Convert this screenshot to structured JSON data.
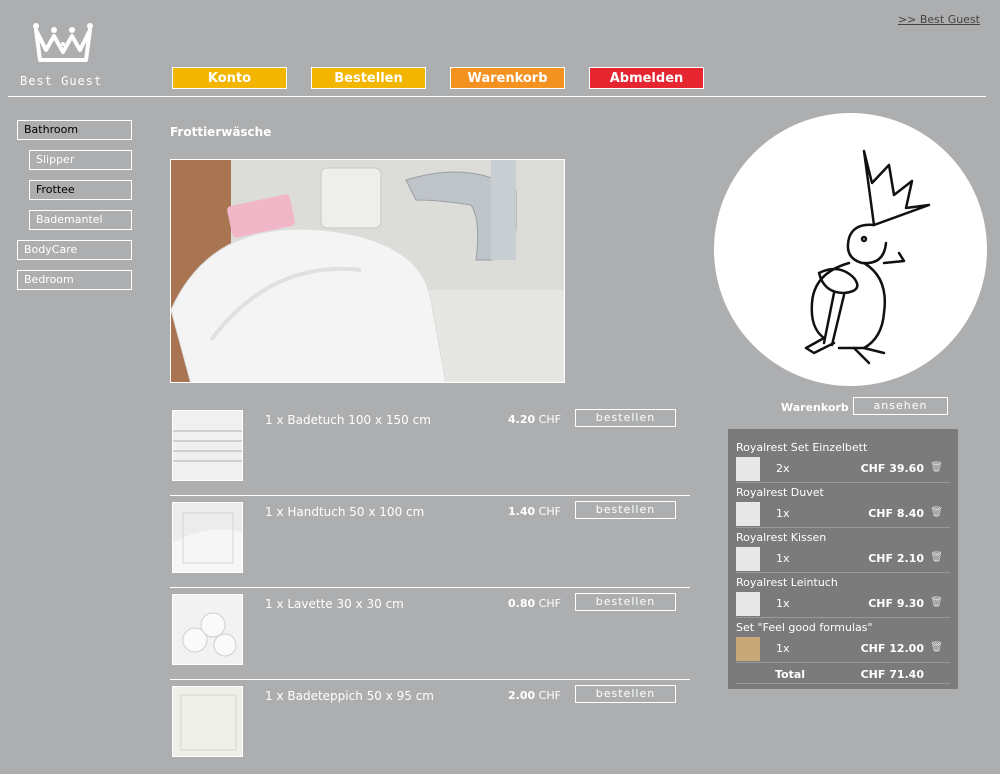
{
  "header": {
    "brand": "Best Guest",
    "top_link": ">> Best Guest",
    "nav": [
      {
        "label": "Konto",
        "color": "#f2b600"
      },
      {
        "label": "Bestellen",
        "color": "#f2b600"
      },
      {
        "label": "Warenkorb",
        "color": "#f39121"
      },
      {
        "label": "Abmelden",
        "color": "#e52630"
      }
    ]
  },
  "sidebar": {
    "items": [
      {
        "label": "Bathroom"
      },
      {
        "label": "Slipper"
      },
      {
        "label": "Frottee"
      },
      {
        "label": "Bademantel"
      },
      {
        "label": "BodyCare"
      },
      {
        "label": "Bedroom"
      }
    ]
  },
  "main": {
    "section_title": "Frottierwäsche",
    "products": [
      {
        "name": "1 x Badetuch 100 x 150 cm",
        "price": "4.20",
        "currency": "CHF",
        "button": "bestellen"
      },
      {
        "name": "1 x Handtuch 50 x 100 cm",
        "price": "1.40",
        "currency": "CHF",
        "button": "bestellen"
      },
      {
        "name": "1 x Lavette 30 x 30 cm",
        "price": "0.80",
        "currency": "CHF",
        "button": "bestellen"
      },
      {
        "name": "1 x Badeteppich 50 x 95 cm",
        "price": "2.00",
        "currency": "CHF",
        "button": "bestellen"
      }
    ]
  },
  "cart": {
    "label": "Warenkorb",
    "view_button": "ansehen",
    "items": [
      {
        "name": "Royalrest Set Einzelbett",
        "qty": "2x",
        "price": "CHF 39.60"
      },
      {
        "name": "Royalrest Duvet",
        "qty": "1x",
        "price": "CHF 8.40"
      },
      {
        "name": "Royalrest Kissen",
        "qty": "1x",
        "price": "CHF 2.10"
      },
      {
        "name": "Royalrest Leintuch",
        "qty": "1x",
        "price": "CHF 9.30"
      },
      {
        "name": "Set \"Feel good formulas\"",
        "qty": "1x",
        "price": "CHF 12.00"
      }
    ],
    "total_label": "Total",
    "total_value": "CHF 71.40"
  }
}
